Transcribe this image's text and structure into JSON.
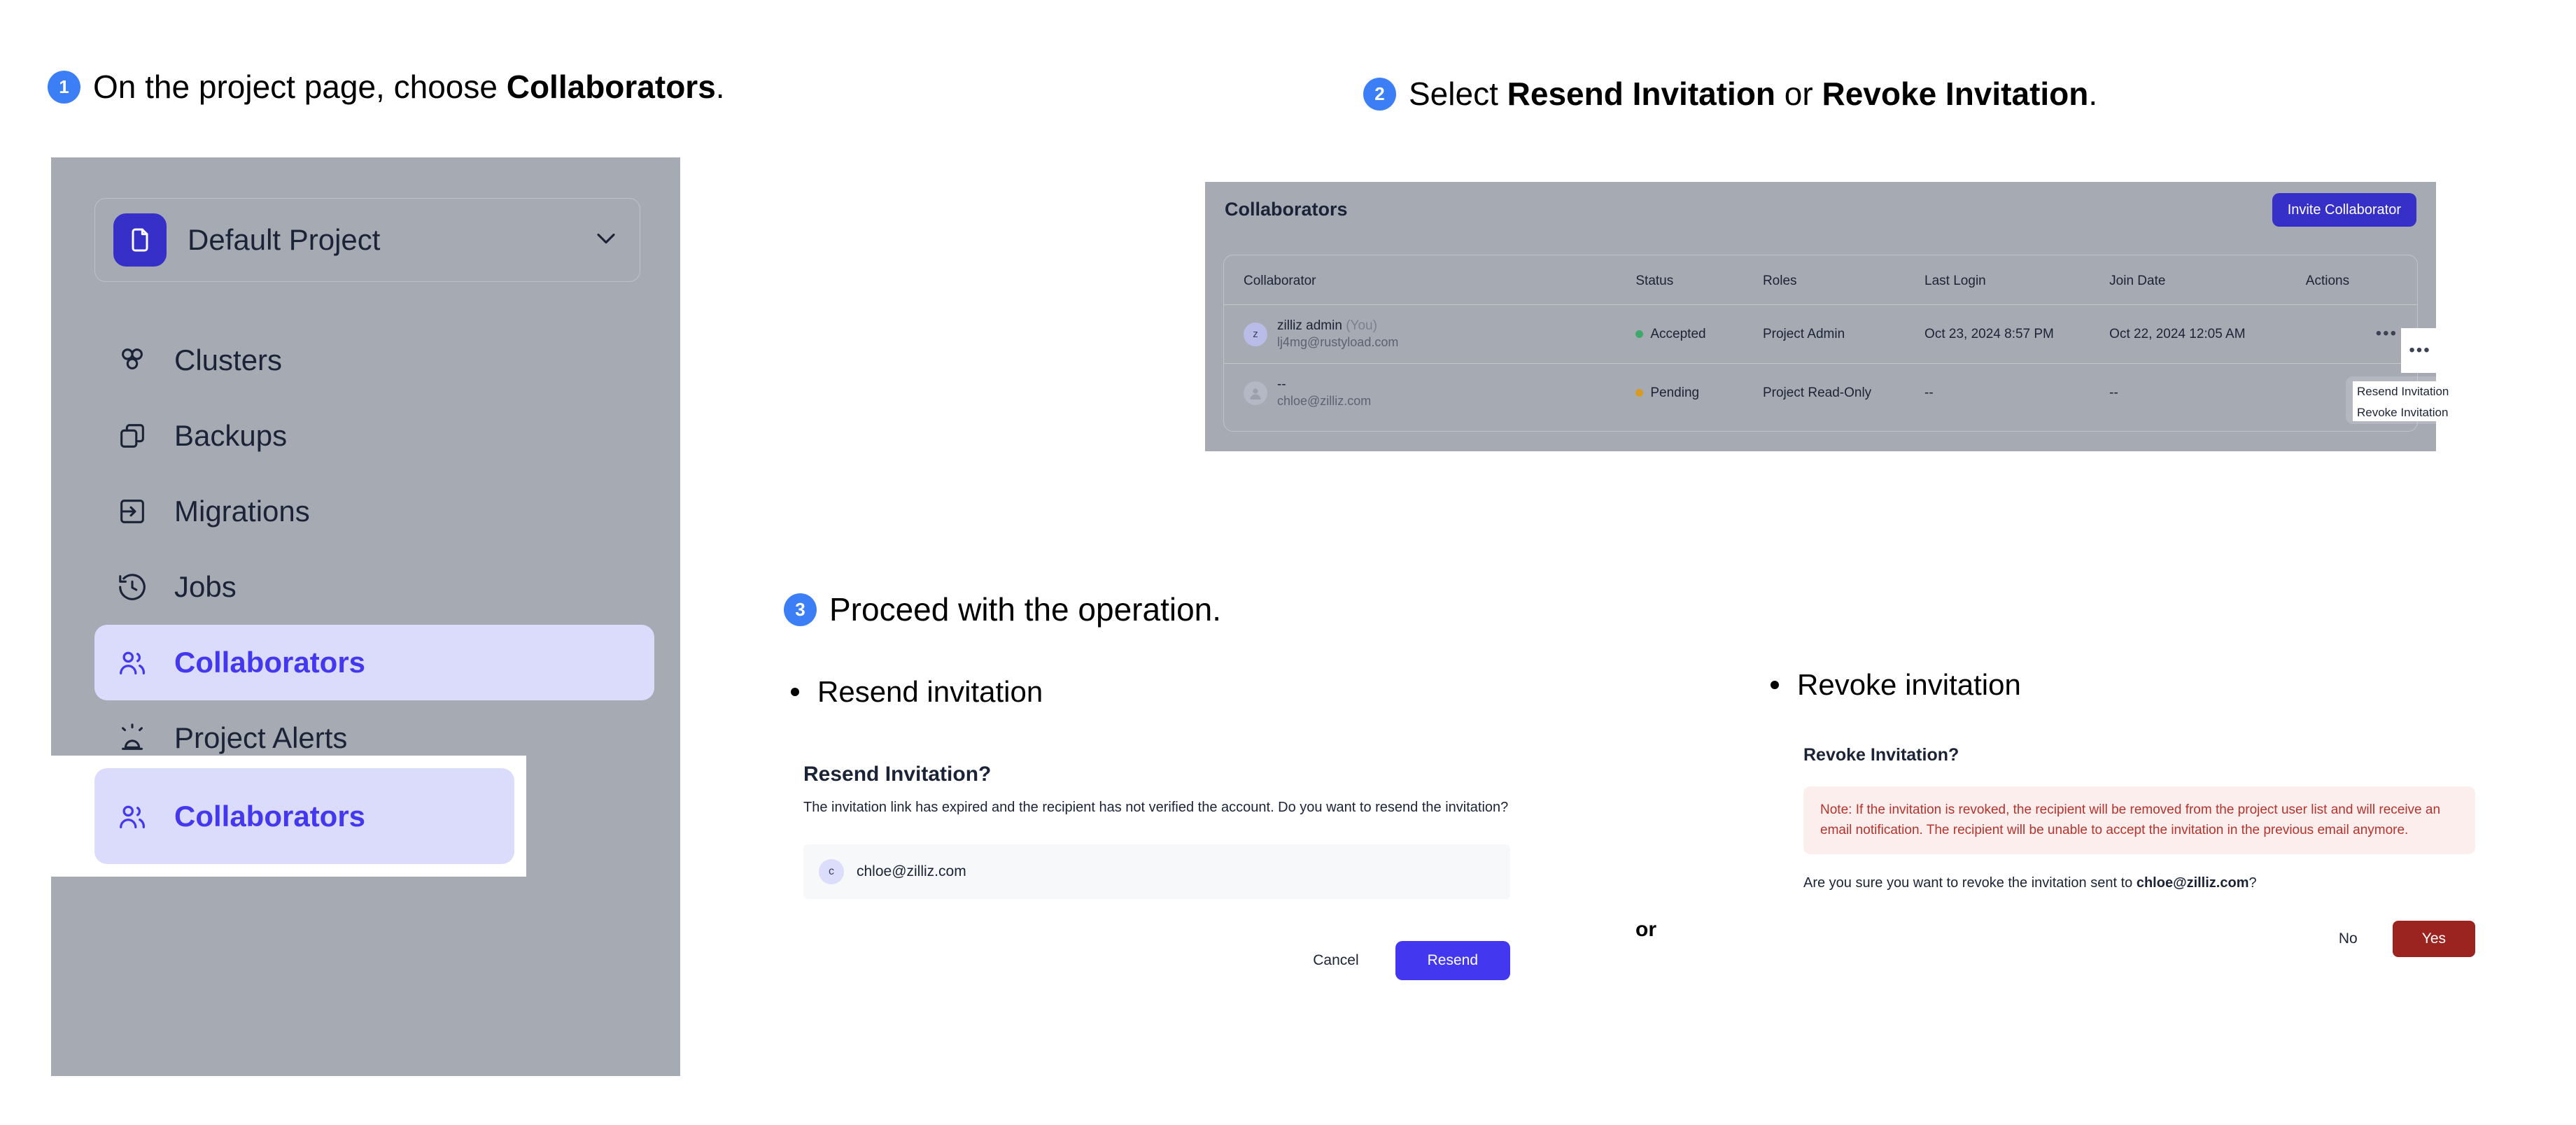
{
  "steps": [
    {
      "num": "1",
      "prefix": "On the project page, choose ",
      "bold": "Collaborators",
      "suffix": "."
    },
    {
      "num": "2",
      "prefix": "Select ",
      "bold": "Resend Invitation",
      "mid": " or ",
      "bold2": "Revoke Invitation",
      "suffix": "."
    },
    {
      "num": "3",
      "prefix": "Proceed with the operation.",
      "bold": "",
      "suffix": ""
    }
  ],
  "sidebar": {
    "project": {
      "name": "Default Project",
      "icon": "folder-icon",
      "chevron": "chevron-down-icon"
    },
    "items": [
      {
        "label": "Clusters",
        "icon": "clusters-icon",
        "active": false
      },
      {
        "label": "Backups",
        "icon": "backups-icon",
        "active": false
      },
      {
        "label": "Migrations",
        "icon": "migrations-icon",
        "active": false
      },
      {
        "label": "Jobs",
        "icon": "jobs-clock-icon",
        "active": false
      },
      {
        "label": "Collaborators",
        "icon": "collaborators-icon",
        "active": true
      },
      {
        "label": "Project Alerts",
        "icon": "alert-siren-icon",
        "active": false
      }
    ]
  },
  "collaborators_panel": {
    "title": "Collaborators",
    "invite_button": "Invite Collaborator",
    "columns": [
      "Collaborator",
      "Status",
      "Roles",
      "Last Login",
      "Join Date",
      "Actions"
    ],
    "rows": [
      {
        "avatar_letter": "z",
        "name": "zilliz admin",
        "name_suffix": "(You)",
        "email": "lj4mg@rustyload.com",
        "status": "Accepted",
        "status_color": "#3ea96a",
        "role": "Project Admin",
        "last_login": "Oct 23, 2024 8:57 PM",
        "join_date": "Oct 22, 2024 12:05 AM",
        "actions": "•••"
      },
      {
        "avatar_letter": "",
        "name": "--",
        "name_suffix": "",
        "email": "chloe@zilliz.com",
        "status": "Pending",
        "status_color": "#d79b21",
        "role": "Project Read-Only",
        "last_login": "--",
        "join_date": "--",
        "actions": "•••"
      }
    ],
    "kebab_glyph": "•••",
    "menu": [
      "Resend Invitation",
      "Revoke Invitation"
    ]
  },
  "resend": {
    "bullet": "Resend invitation",
    "title": "Resend Invitation?",
    "body": "The invitation link has expired and the recipient has not verified the account. Do you want to resend the invitation?",
    "chip_avatar_letter": "c",
    "chip_email": "chloe@zilliz.com",
    "cancel_label": "Cancel",
    "confirm_label": "Resend",
    "primary_color": "#4338f0"
  },
  "revoke": {
    "bullet": "Revoke invitation",
    "title": "Revoke Invitation?",
    "note": "Note: If the invitation is revoked, the recipient will be removed from the project user list and will receive an email notification. The recipient will be unable to accept the invitation in the previous email anymore.",
    "note_color": "#b4332c",
    "question_prefix": "Are you sure you want to revoke the invitation sent to ",
    "question_email": "chloe@zilliz.com",
    "question_suffix": "?",
    "no_label": "No",
    "yes_label": "Yes",
    "danger_color": "#9b2420"
  },
  "or_label": "or"
}
